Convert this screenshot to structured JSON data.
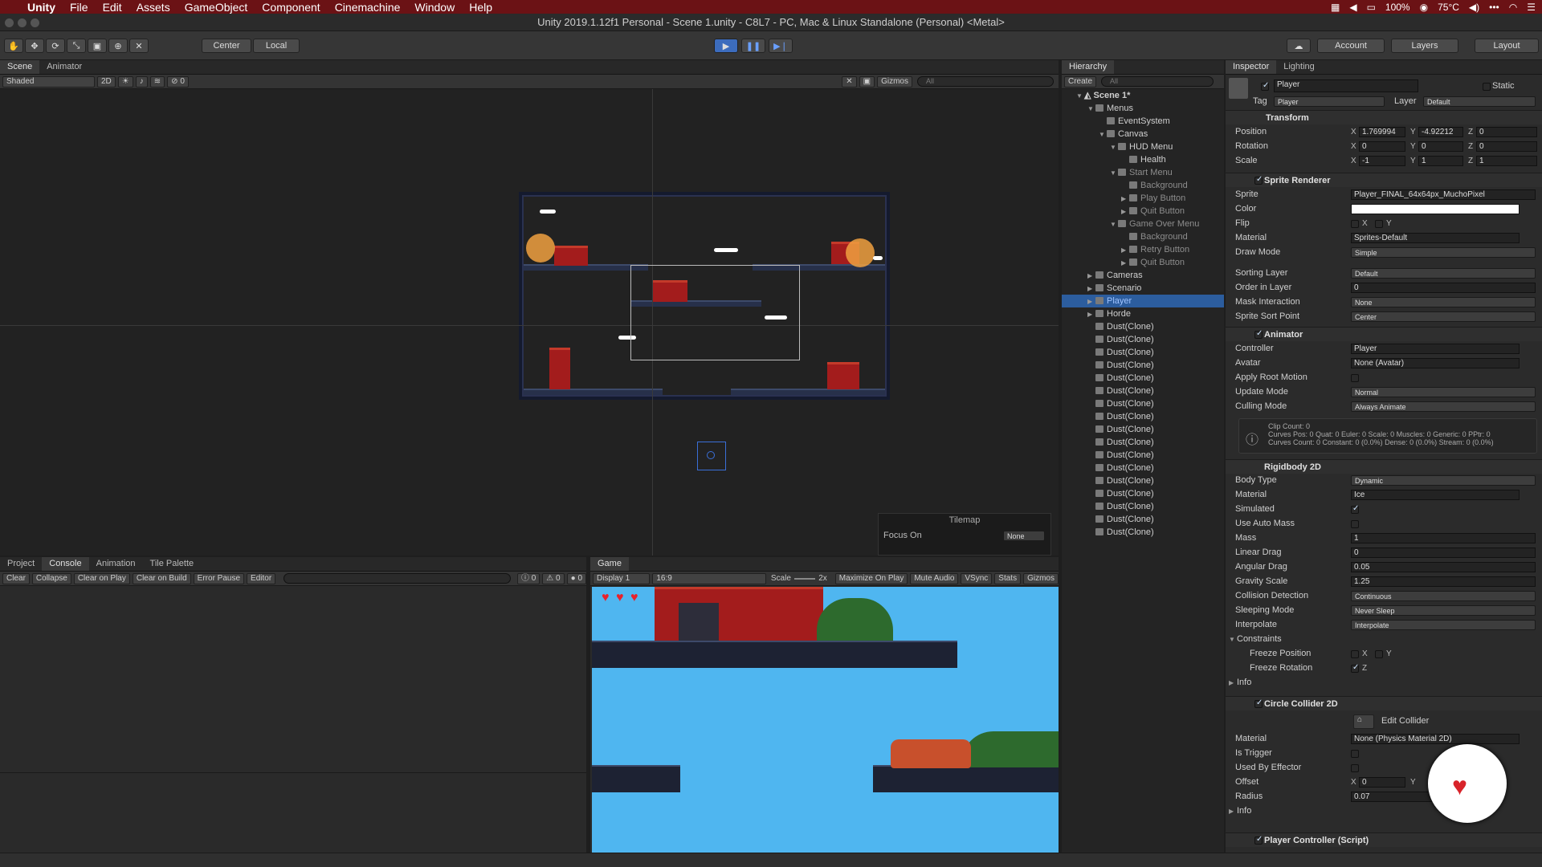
{
  "menubar": {
    "app": "Unity",
    "items": [
      "File",
      "Edit",
      "Assets",
      "GameObject",
      "Component",
      "Cinemachine",
      "Window",
      "Help"
    ],
    "battery": "100%",
    "temp": "75°C"
  },
  "window": {
    "title": "Unity 2019.1.12f1 Personal - Scene 1.unity - C8L7 - PC, Mac & Linux Standalone (Personal) <Metal>"
  },
  "toolbar": {
    "pivot": "Center",
    "space": "Local",
    "account": "Account",
    "layers": "Layers",
    "layout": "Layout"
  },
  "scene": {
    "tabs": [
      "Scene",
      "Animator"
    ],
    "shading": "Shaded",
    "mode2d": "2D",
    "gizmos": "Gizmos",
    "search_placeholder": "All",
    "layer_count": "0",
    "tilemap_title": "Tilemap",
    "focus_label": "Focus On",
    "focus_value": "None"
  },
  "hierarchy": {
    "tab": "Hierarchy",
    "create": "Create",
    "search_placeholder": "All",
    "scene": "Scene 1*",
    "items": [
      {
        "label": "Menus",
        "depth": 1,
        "arrow": "down",
        "cube": true
      },
      {
        "label": "EventSystem",
        "depth": 2,
        "arrow": "",
        "cube": true
      },
      {
        "label": "Canvas",
        "depth": 2,
        "arrow": "down",
        "cube": true
      },
      {
        "label": "HUD Menu",
        "depth": 3,
        "arrow": "down",
        "cube": true
      },
      {
        "label": "Health",
        "depth": 4,
        "arrow": "",
        "cube": true
      },
      {
        "label": "Start Menu",
        "depth": 3,
        "arrow": "down",
        "cube": true,
        "dim": true
      },
      {
        "label": "Background",
        "depth": 4,
        "arrow": "",
        "cube": true,
        "dim": true
      },
      {
        "label": "Play Button",
        "depth": 4,
        "arrow": "right",
        "cube": true,
        "dim": true
      },
      {
        "label": "Quit Button",
        "depth": 4,
        "arrow": "right",
        "cube": true,
        "dim": true
      },
      {
        "label": "Game Over Menu",
        "depth": 3,
        "arrow": "down",
        "cube": true,
        "dim": true
      },
      {
        "label": "Background",
        "depth": 4,
        "arrow": "",
        "cube": true,
        "dim": true
      },
      {
        "label": "Retry Button",
        "depth": 4,
        "arrow": "right",
        "cube": true,
        "dim": true
      },
      {
        "label": "Quit Button",
        "depth": 4,
        "arrow": "right",
        "cube": true,
        "dim": true
      },
      {
        "label": "Cameras",
        "depth": 1,
        "arrow": "right",
        "cube": true
      },
      {
        "label": "Scenario",
        "depth": 1,
        "arrow": "right",
        "cube": true
      },
      {
        "label": "Player",
        "depth": 1,
        "arrow": "right",
        "cube": true,
        "selected": true
      },
      {
        "label": "Horde",
        "depth": 1,
        "arrow": "right",
        "cube": true
      },
      {
        "label": "Dust(Clone)",
        "depth": 1,
        "arrow": "",
        "cube": true
      },
      {
        "label": "Dust(Clone)",
        "depth": 1,
        "arrow": "",
        "cube": true
      },
      {
        "label": "Dust(Clone)",
        "depth": 1,
        "arrow": "",
        "cube": true
      },
      {
        "label": "Dust(Clone)",
        "depth": 1,
        "arrow": "",
        "cube": true
      },
      {
        "label": "Dust(Clone)",
        "depth": 1,
        "arrow": "",
        "cube": true
      },
      {
        "label": "Dust(Clone)",
        "depth": 1,
        "arrow": "",
        "cube": true
      },
      {
        "label": "Dust(Clone)",
        "depth": 1,
        "arrow": "",
        "cube": true
      },
      {
        "label": "Dust(Clone)",
        "depth": 1,
        "arrow": "",
        "cube": true
      },
      {
        "label": "Dust(Clone)",
        "depth": 1,
        "arrow": "",
        "cube": true
      },
      {
        "label": "Dust(Clone)",
        "depth": 1,
        "arrow": "",
        "cube": true
      },
      {
        "label": "Dust(Clone)",
        "depth": 1,
        "arrow": "",
        "cube": true
      },
      {
        "label": "Dust(Clone)",
        "depth": 1,
        "arrow": "",
        "cube": true
      },
      {
        "label": "Dust(Clone)",
        "depth": 1,
        "arrow": "",
        "cube": true
      },
      {
        "label": "Dust(Clone)",
        "depth": 1,
        "arrow": "",
        "cube": true
      },
      {
        "label": "Dust(Clone)",
        "depth": 1,
        "arrow": "",
        "cube": true
      },
      {
        "label": "Dust(Clone)",
        "depth": 1,
        "arrow": "",
        "cube": true
      },
      {
        "label": "Dust(Clone)",
        "depth": 1,
        "arrow": "",
        "cube": true
      }
    ]
  },
  "inspector": {
    "tabs": [
      "Inspector",
      "Lighting"
    ],
    "name": "Player",
    "static": "Static",
    "tag_label": "Tag",
    "tag": "Player",
    "layer_label": "Layer",
    "layer": "Default",
    "transform": {
      "title": "Transform",
      "pos_label": "Position",
      "px": "1.769994",
      "py": "-4.92212",
      "pz": "0",
      "rot_label": "Rotation",
      "rx": "0",
      "ry": "0",
      "rz": "0",
      "scale_label": "Scale",
      "sx": "-1",
      "sy": "1",
      "sz": "1"
    },
    "sprite": {
      "title": "Sprite Renderer",
      "sprite_label": "Sprite",
      "sprite": "Player_FINAL_64x64px_MuchoPixel",
      "color_label": "Color",
      "flip_label": "Flip",
      "material_label": "Material",
      "material": "Sprites-Default",
      "drawmode_label": "Draw Mode",
      "drawmode": "Simple",
      "sortlayer_label": "Sorting Layer",
      "sortlayer": "Default",
      "order_label": "Order in Layer",
      "order": "0",
      "mask_label": "Mask Interaction",
      "mask": "None",
      "sortpoint_label": "Sprite Sort Point",
      "sortpoint": "Center"
    },
    "animator": {
      "title": "Animator",
      "controller_label": "Controller",
      "controller": "Player",
      "avatar_label": "Avatar",
      "avatar": "None (Avatar)",
      "rootmotion_label": "Apply Root Motion",
      "update_label": "Update Mode",
      "update": "Normal",
      "culling_label": "Culling Mode",
      "culling": "Always Animate",
      "info1": "Clip Count: 0",
      "info2": "Curves Pos: 0 Quat: 0 Euler: 0 Scale: 0 Muscles: 0 Generic: 0 PPtr: 0",
      "info3": "Curves Count: 0 Constant: 0 (0.0%) Dense: 0 (0.0%) Stream: 0 (0.0%)"
    },
    "rigidbody": {
      "title": "Rigidbody 2D",
      "bodytype_label": "Body Type",
      "bodytype": "Dynamic",
      "material_label": "Material",
      "material": "Ice",
      "simulated_label": "Simulated",
      "autoMass_label": "Use Auto Mass",
      "mass_label": "Mass",
      "mass": "1",
      "ldrag_label": "Linear Drag",
      "ldrag": "0",
      "adrag_label": "Angular Drag",
      "adrag": "0.05",
      "gravity_label": "Gravity Scale",
      "gravity": "1.25",
      "collision_label": "Collision Detection",
      "collision": "Continuous",
      "sleep_label": "Sleeping Mode",
      "sleep": "Never Sleep",
      "interp_label": "Interpolate",
      "interp": "Interpolate",
      "constraints_label": "Constraints",
      "freezepos_label": "Freeze Position",
      "freezerot_label": "Freeze Rotation",
      "info_label": "Info"
    },
    "circle": {
      "title": "Circle Collider 2D",
      "edit": "Edit Collider",
      "material_label": "Material",
      "material": "None (Physics Material 2D)",
      "trigger_label": "Is Trigger",
      "effector_label": "Used By Effector",
      "offset_label": "Offset",
      "ox": "0",
      "radius_label": "Radius",
      "radius": "0.07",
      "info_label": "Info"
    },
    "script": {
      "title": "Player Controller (Script)"
    }
  },
  "bottom": {
    "tabs": [
      "Project",
      "Console",
      "Animation",
      "Tile Palette"
    ],
    "buttons": [
      "Clear",
      "Collapse",
      "Clear on Play",
      "Clear on Build",
      "Error Pause",
      "Editor"
    ],
    "counts": [
      "0",
      "0",
      "0"
    ]
  },
  "game": {
    "tab": "Game",
    "display": "Display 1",
    "aspect": "16:9",
    "scale_label": "Scale",
    "scale": "2x",
    "options": [
      "Maximize On Play",
      "Mute Audio",
      "VSync",
      "Stats",
      "Gizmos"
    ]
  },
  "colors": {
    "menubar": "#6b1215",
    "selection": "#2c5d9e",
    "sky": "#4fb6f0"
  }
}
